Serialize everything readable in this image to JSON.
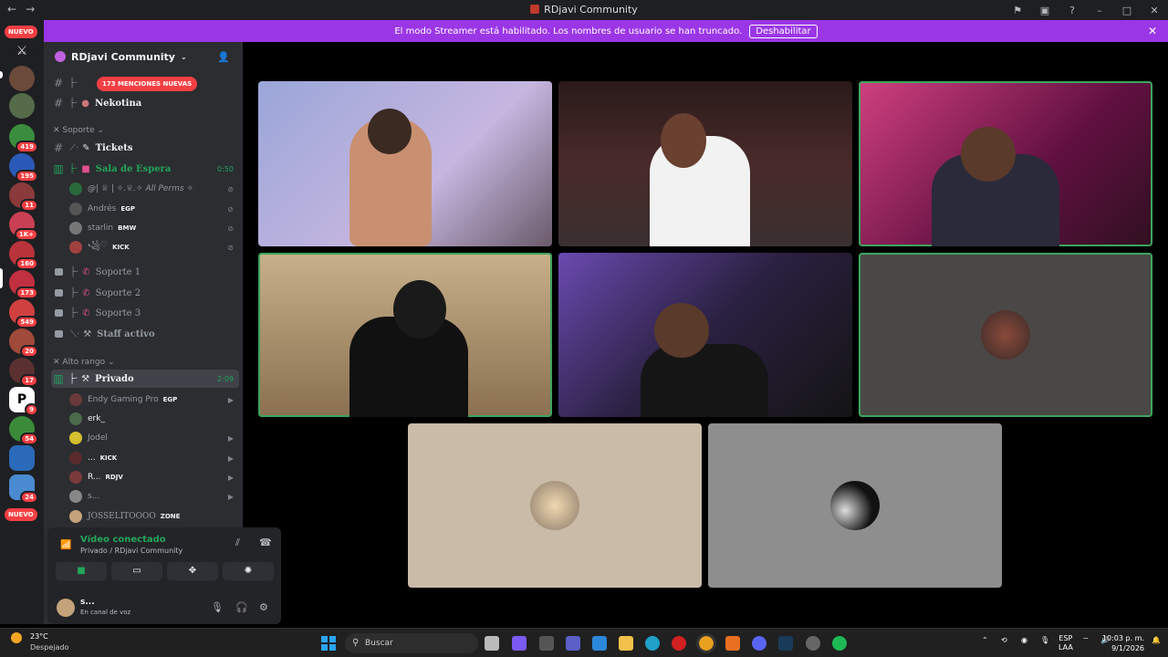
{
  "window": {
    "title": "RDjavi Community",
    "nav_back": "←",
    "nav_forward": "→"
  },
  "banner": {
    "text": "El modo Streamer está habilitado. Los nombres de usuario se han truncado.",
    "button": "Deshabilitar"
  },
  "rail": {
    "nuevo_top": "NUEVO",
    "nuevo_bottom": "NUEVO",
    "badges": [
      "419",
      "195",
      "11",
      "1K+",
      "160",
      "173",
      "549",
      "20",
      "17",
      "9",
      "54",
      "24"
    ]
  },
  "guild": {
    "name": "RDjavi Community"
  },
  "mentions_pill": "173 MENCIONES NUEVAS",
  "channels": {
    "nekotina": "Nekotina",
    "cat_soporte": "Soporte",
    "tickets": "Tickets",
    "sala_espera": "Sala de Espera",
    "sala_espera_time": "0:50",
    "soporte1": "Soporte 1",
    "soporte2": "Soporte 2",
    "soporte3": "Soporte 3",
    "staff": "Staff activo",
    "cat_alto": "Alto rango",
    "privado": "Privado",
    "privado_time": "2:09"
  },
  "sala_users": [
    {
      "name": "@| ♕ | ✧.♕.✧ All Perms ✧",
      "tag": ""
    },
    {
      "name": "Andrés",
      "tag": "EGP"
    },
    {
      "name": "starlin",
      "tag": "BMW"
    },
    {
      "name": "꧁♡",
      "tag": "KICK"
    }
  ],
  "privado_users": [
    {
      "name": "Endy Gaming Pro",
      "tag": "EGP"
    },
    {
      "name": "erk_",
      "tag": ""
    },
    {
      "name": "Jodel",
      "tag": ""
    },
    {
      "name": "...",
      "tag": "KICK"
    },
    {
      "name": "R...",
      "tag": "RDJV"
    },
    {
      "name": "s...",
      "tag": ""
    },
    {
      "name": "JOSSELITOOOO",
      "tag": "ZONE"
    }
  ],
  "voice": {
    "status": "Vídeo conectado",
    "location": "Privado / RDjavi Community"
  },
  "me": {
    "name": "s...",
    "status": "En canal de voz"
  },
  "taskbar": {
    "temp": "23°C",
    "weather": "Despejado",
    "search": "Buscar",
    "lang1": "ESP",
    "lang2": "LAA",
    "time": "10:03 p. m.",
    "date": "9/1/2026"
  },
  "colors": {
    "accent_green": "#23a55a",
    "streamer_banner": "#9b36e6",
    "mention_red": "#f23f43"
  }
}
